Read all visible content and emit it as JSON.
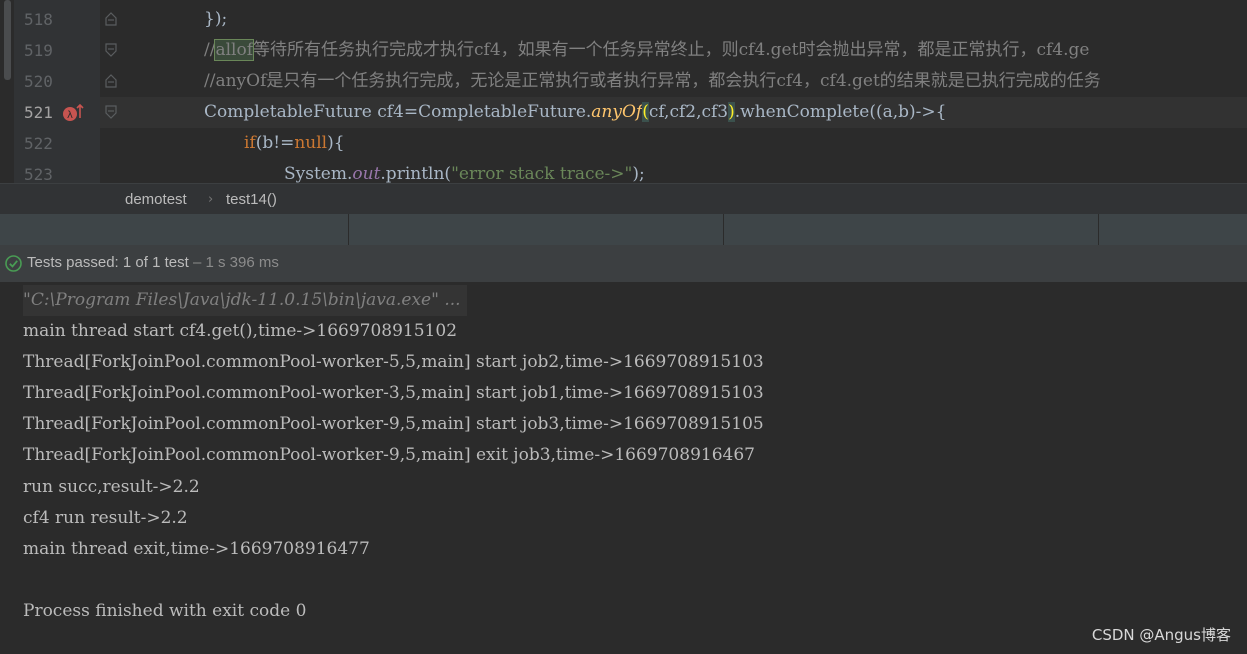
{
  "editor": {
    "lines": [
      {
        "number": "518",
        "text": "});"
      },
      {
        "number": "519",
        "highlight": "allof",
        "rest": "等待所有任务执行完成才执行cf4，如果有一个任务异常终止，则cf4.get时会抛出异常，都是正常执行，cf4.ge"
      },
      {
        "number": "520",
        "text": "//anyOf是只有一个任务执行完成，无论是正常执行或者执行异常，都会执行cf4，cf4.get的结果就是已执行完成的任务"
      },
      {
        "number": "521",
        "p1": "CompletableFuture cf4=CompletableFuture.",
        "p2": "anyOf",
        "p3": "(",
        "p4": "cf,cf2,cf3",
        "p5": ")",
        "p6": ".whenComplete((a,b)->{"
      },
      {
        "number": "522",
        "kw": "if",
        "mid": "(b!=",
        "kw2": "null",
        "end": "){"
      },
      {
        "number": "523",
        "p1": "System.",
        "p2": "out",
        "p3": ".println(",
        "p4": "\"error stack trace->\"",
        "p5": ");"
      }
    ],
    "comment_prefix": "//"
  },
  "breadcrumb": {
    "items": [
      "demotest",
      "test14()"
    ],
    "separator": "›"
  },
  "test_status": {
    "label": "Tests passed:",
    "count": "1",
    "of": "of 1 test",
    "duration": "– 1 s 396 ms"
  },
  "console": {
    "command": "\"C:\\Program Files\\Java\\jdk-11.0.15\\bin\\java.exe\" ...",
    "lines": [
      "main thread start cf4.get(),time->1669708915102",
      "Thread[ForkJoinPool.commonPool-worker-5,5,main] start job2,time->1669708915103",
      "Thread[ForkJoinPool.commonPool-worker-3,5,main] start job1,time->1669708915103",
      "Thread[ForkJoinPool.commonPool-worker-9,5,main] start job3,time->1669708915105",
      "Thread[ForkJoinPool.commonPool-worker-9,5,main] exit job3,time->1669708916467",
      "run succ,result->2.2",
      "cf4 run result->2.2",
      "main thread exit,time->1669708916477",
      "",
      "Process finished with exit code 0"
    ]
  },
  "watermark": "CSDN @Angus博客",
  "colors": {
    "background": "#2b2b2b",
    "gutter": "#313335",
    "pass_green": "#499c54",
    "keyword": "#cc7832",
    "string": "#6a8759",
    "method_italic": "#ffc66d"
  }
}
